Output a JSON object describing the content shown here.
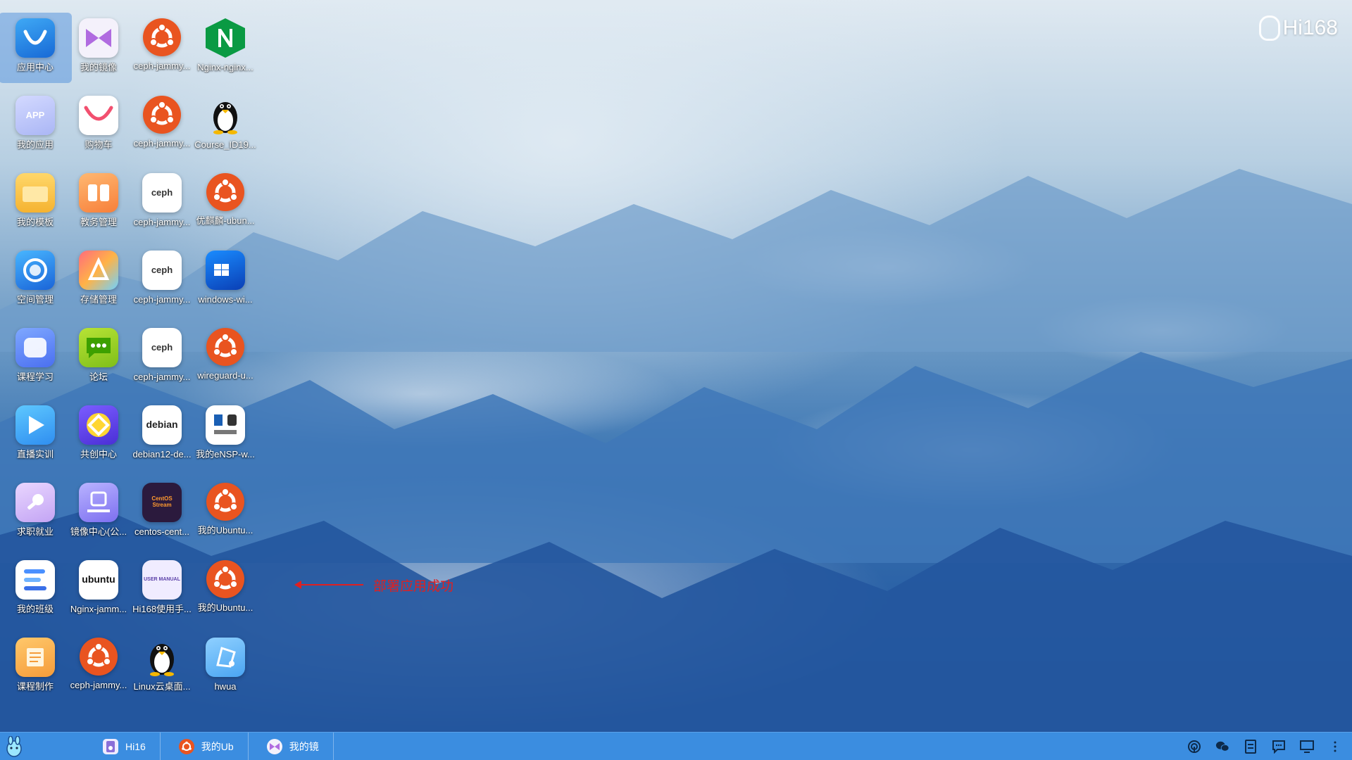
{
  "wallpaper": {
    "brand": "Hi168"
  },
  "desktop_icons": [
    {
      "label": "应用中心",
      "icon": "app-store-icon"
    },
    {
      "label": "我的镜像",
      "icon": "my-mirror-icon"
    },
    {
      "label": "ceph-jammy...",
      "icon": "ubuntu-icon"
    },
    {
      "label": "Nginx-nginx...",
      "icon": "nginx-icon"
    },
    {
      "label": "我的应用",
      "icon": "my-apps-icon",
      "text": "APP"
    },
    {
      "label": "购物车",
      "icon": "shopping-cart-icon"
    },
    {
      "label": "ceph-jammy...",
      "icon": "ubuntu-icon"
    },
    {
      "label": "Course_ID19...",
      "icon": "linux-penguin-icon"
    },
    {
      "label": "我的模板",
      "icon": "folder-icon"
    },
    {
      "label": "教务管理",
      "icon": "academic-admin-icon"
    },
    {
      "label": "ceph-jammy...",
      "icon": "ceph-icon",
      "text": "ceph"
    },
    {
      "label": "优麒麟-ubun...",
      "icon": "ubuntu-icon"
    },
    {
      "label": "空间管理",
      "icon": "space-management-icon"
    },
    {
      "label": "存储管理",
      "icon": "storage-management-icon"
    },
    {
      "label": "ceph-jammy...",
      "icon": "ceph-icon",
      "text": "ceph"
    },
    {
      "label": "windows-wi...",
      "icon": "windows-icon"
    },
    {
      "label": "课程学习",
      "icon": "course-study-icon"
    },
    {
      "label": "论坛",
      "icon": "forum-icon"
    },
    {
      "label": "ceph-jammy...",
      "icon": "ceph-icon",
      "text": "ceph"
    },
    {
      "label": "wireguard-u...",
      "icon": "ubuntu-icon"
    },
    {
      "label": "直播实训",
      "icon": "live-training-icon"
    },
    {
      "label": "共创中心",
      "icon": "co-creation-icon"
    },
    {
      "label": "debian12-de...",
      "icon": "debian-icon",
      "text": "debian"
    },
    {
      "label": "我的eNSP-w...",
      "icon": "ensp-icon"
    },
    {
      "label": "求职就业",
      "icon": "job-icon"
    },
    {
      "label": "镜像中心(公...",
      "icon": "mirror-center-icon"
    },
    {
      "label": "centos-cent...",
      "icon": "centos-icon",
      "text": "CentOS Stream"
    },
    {
      "label": "我的Ubuntu...",
      "icon": "ubuntu-icon"
    },
    {
      "label": "我的班级",
      "icon": "my-class-icon"
    },
    {
      "label": "Nginx-jamm...",
      "icon": "ubuntu-logo-icon",
      "text": "ubuntu"
    },
    {
      "label": "Hi168使用手...",
      "icon": "user-manual-icon",
      "text": "USER MANUAL"
    },
    {
      "label": "我的Ubuntu...",
      "icon": "ubuntu-icon"
    },
    {
      "label": "课程制作",
      "icon": "course-making-icon"
    },
    {
      "label": "ceph-jammy...",
      "icon": "ubuntu-icon"
    },
    {
      "label": "Linux云桌面...",
      "icon": "linux-penguin-icon"
    },
    {
      "label": "hwua",
      "icon": "hwua-icon"
    }
  ],
  "annotation": {
    "text": "部署应用成功",
    "color": "#e02020"
  },
  "taskbar": {
    "tasks": [
      {
        "label": "Hi16",
        "icon": "user-manual-icon"
      },
      {
        "label": "我的Ub",
        "icon": "ubuntu-icon"
      },
      {
        "label": "我的镜",
        "icon": "my-mirror-icon"
      }
    ],
    "tray": [
      "hotspot-icon",
      "wechat-icon",
      "notes-icon",
      "chat-icon",
      "monitor-icon",
      "more-icon"
    ],
    "color": "#3b8de0"
  }
}
